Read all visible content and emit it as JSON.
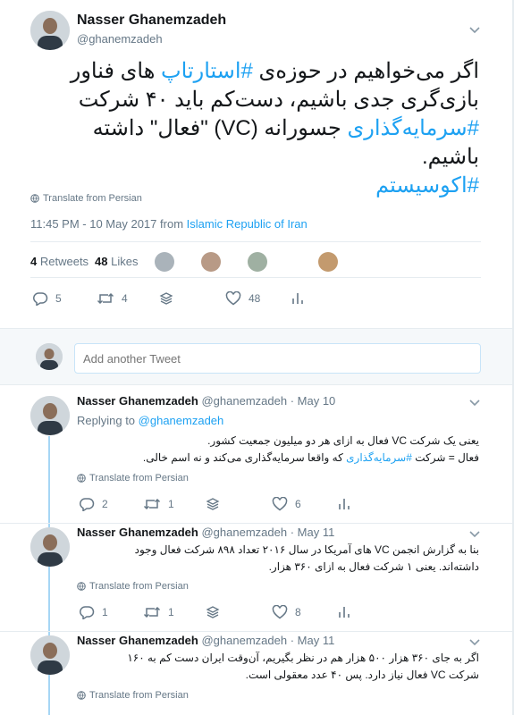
{
  "main_tweet": {
    "name": "Nasser Ghanemzadeh",
    "handle": "@ghanemzadeh",
    "text_part1": "اگر می‌خواهیم در حوزه‌ی ",
    "hashtag1": "#استارتاپ",
    "text_part2": " های فناور بازی‌گری جدی باشیم، دست‌کم باید ۴۰ شرکت ",
    "hashtag2": "#سرمایه‌گذاری",
    "text_part3": " جسورانه (VC) \"فعال\" داشته باشیم.",
    "hashtag3": "#اکوسیستم",
    "translate": "Translate from Persian",
    "time": "11:45 PM - 10 May 2017",
    "from": "from",
    "location": "Islamic Republic of Iran",
    "retweets_count": "4",
    "retweets_label": "Retweets",
    "likes_count": "48",
    "likes_label": "Likes",
    "reply_count": "5",
    "retweet_action_count": "4",
    "like_action_count": "48"
  },
  "reply_box": {
    "placeholder": "Add another Tweet"
  },
  "replies": [
    {
      "name": "Nasser Ghanemzadeh",
      "handle": "@ghanemzadeh",
      "date": "· May 10",
      "replying_label": "Replying to",
      "replying_to": "@ghanemzadeh",
      "line1": "یعنی یک شرکت VC فعال به ازای هر دو میلیون جمعیت کشور.",
      "line2_a": "فعال = شرکت ",
      "line2_tag": "#سرمایه‌گذاری",
      "line2_b": " که واقعا سرمایه‌گذاری می‌کند و نه اسم خالی.",
      "translate": "Translate from Persian",
      "reply_count": "2",
      "retweet_count": "1",
      "like_count": "6"
    },
    {
      "name": "Nasser Ghanemzadeh",
      "handle": "@ghanemzadeh",
      "date": "· May 11",
      "line1": "بنا به گزارش انجمن VC های آمریکا در سال ۲۰۱۶ تعداد ۸۹۸ شرکت فعال وجود",
      "line2": "داشته‌اند. یعنی ۱ شرکت فعال به ازای ۳۶۰ هزار.",
      "translate": "Translate from Persian",
      "reply_count": "1",
      "retweet_count": "1",
      "like_count": "8"
    },
    {
      "name": "Nasser Ghanemzadeh",
      "handle": "@ghanemzadeh",
      "date": "· May 11",
      "line1": "اگر به جای ۳۶۰ هزار ۵۰۰ هزار هم در نظر بگیریم، آن‌وقت ایران دست کم به ۱۶۰",
      "line2": "شرکت VC فعال نیاز دارد. پس ۴۰ عدد معقولی است.",
      "translate": "Translate from Persian"
    }
  ],
  "colors": {
    "accent": "#1da1f2",
    "grey": "#657786",
    "thread": "#a6d6f5"
  }
}
